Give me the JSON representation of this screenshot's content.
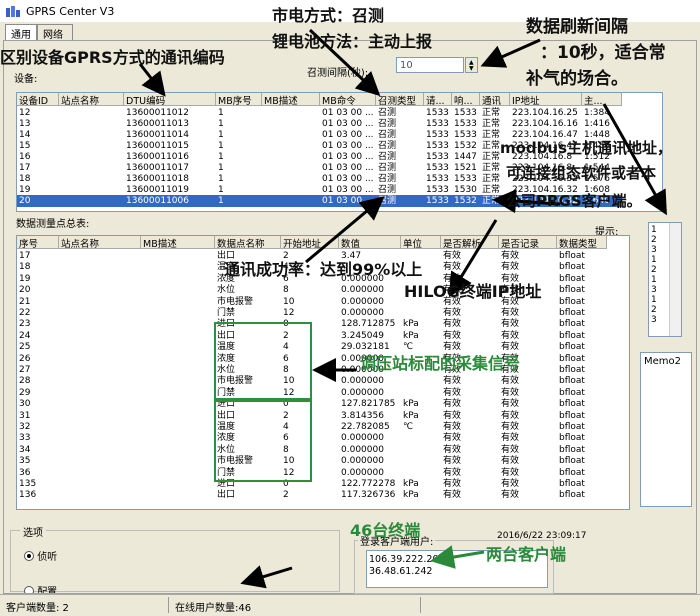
{
  "window": {
    "title": "GPRS Center V3"
  },
  "tabs": [
    "通用",
    "网络"
  ],
  "labels": {
    "devices": "设备:",
    "poll_interval": "召测间隔(秒):",
    "data_points_summary": "数据测量点总表:",
    "hint": "提示:",
    "options": "选项",
    "login_users": "登录客户端用户:",
    "datetime": "2016/6/22 23:09:17"
  },
  "poll_interval_value": "10",
  "device_table": {
    "columns": [
      "设备ID",
      "站点名称",
      "DTU编码",
      "MB序号",
      "MB描述",
      "MB命令",
      "召测类型",
      "请...",
      "响...",
      "通讯",
      "IP地址",
      "主..."
    ],
    "rows": [
      [
        "12",
        "",
        "13600011012",
        "1",
        "",
        "01 03 00 ...",
        "召测",
        "1533",
        "1533",
        "正常",
        "223.104.16.25",
        "1:384"
      ],
      [
        "13",
        "",
        "13600011013",
        "1",
        "",
        "01 03 00 ...",
        "召测",
        "1533",
        "1533",
        "正常",
        "223.104.16.16",
        "1:416"
      ],
      [
        "14",
        "",
        "13600011014",
        "1",
        "",
        "01 03 00 ...",
        "召测",
        "1533",
        "1533",
        "正常",
        "223.104.16.47",
        "1:448"
      ],
      [
        "15",
        "",
        "13600011015",
        "1",
        "",
        "01 03 00 ...",
        "召测",
        "1533",
        "1532",
        "正常",
        "223.104.16.47",
        "1:480"
      ],
      [
        "16",
        "",
        "13600011016",
        "1",
        "",
        "01 03 00 ...",
        "召测",
        "1533",
        "1447",
        "正常",
        "223.104.16.8",
        "1:512"
      ],
      [
        "17",
        "",
        "13600011017",
        "1",
        "",
        "01 03 00 ...",
        "召测",
        "1533",
        "1521",
        "正常",
        "223.104.16.8",
        "1:544"
      ],
      [
        "18",
        "",
        "13600011018",
        "1",
        "",
        "01 03 00 ...",
        "召测",
        "1533",
        "1533",
        "正常",
        "223.104.16.32",
        "1:576"
      ],
      [
        "19",
        "",
        "13600011019",
        "1",
        "",
        "01 03 00 ...",
        "召测",
        "1533",
        "1530",
        "正常",
        "223.104.16.32",
        "1:608"
      ],
      [
        "20",
        "",
        "13600011006",
        "1",
        "",
        "01 03 00 ...",
        "召测",
        "1533",
        "1532",
        "正常",
        "223.104.16.32",
        "1:640"
      ]
    ]
  },
  "points_table": {
    "columns": [
      "序号",
      "站点名称",
      "MB描述",
      "数据点名称",
      "开始地址",
      "数值",
      "单位",
      "是否解析",
      "是否记录",
      "数据类型"
    ],
    "rows": [
      [
        "17",
        "",
        "",
        "出口",
        "2",
        "3.47",
        "",
        "有效",
        "有效",
        "bfloat"
      ],
      [
        "18",
        "",
        "",
        "温度",
        "4",
        "",
        "",
        "有效",
        "有效",
        "bfloat"
      ],
      [
        "19",
        "",
        "",
        "浓度",
        "6",
        "0.000000",
        "",
        "有效",
        "有效",
        "bfloat"
      ],
      [
        "20",
        "",
        "",
        "水位",
        "8",
        "0.000000",
        "",
        "有效",
        "有效",
        "bfloat"
      ],
      [
        "21",
        "",
        "",
        "市电报警",
        "10",
        "0.000000",
        "",
        "有效",
        "有效",
        "bfloat"
      ],
      [
        "22",
        "",
        "",
        "门禁",
        "12",
        "0.000000",
        "",
        "有效",
        "有效",
        "bfloat"
      ],
      [
        "23",
        "",
        "",
        "进口",
        "0",
        "128.712875",
        "kPa",
        "有效",
        "有效",
        "bfloat"
      ],
      [
        "24",
        "",
        "",
        "出口",
        "2",
        "3.245049",
        "kPa",
        "有效",
        "有效",
        "bfloat"
      ],
      [
        "25",
        "",
        "",
        "温度",
        "4",
        "29.032181",
        "℃",
        "有效",
        "有效",
        "bfloat"
      ],
      [
        "26",
        "",
        "",
        "浓度",
        "6",
        "0.000000",
        "",
        "有效",
        "有效",
        "bfloat"
      ],
      [
        "27",
        "",
        "",
        "水位",
        "8",
        "0.000000",
        "",
        "有效",
        "有效",
        "bfloat"
      ],
      [
        "28",
        "",
        "",
        "市电报警",
        "10",
        "0.000000",
        "",
        "有效",
        "有效",
        "bfloat"
      ],
      [
        "29",
        "",
        "",
        "门禁",
        "12",
        "0.000000",
        "",
        "有效",
        "有效",
        "bfloat"
      ],
      [
        "30",
        "",
        "",
        "进口",
        "0",
        "127.821785",
        "kPa",
        "有效",
        "有效",
        "bfloat"
      ],
      [
        "31",
        "",
        "",
        "出口",
        "2",
        "3.814356",
        "kPa",
        "有效",
        "有效",
        "bfloat"
      ],
      [
        "32",
        "",
        "",
        "温度",
        "4",
        "22.782085",
        "℃",
        "有效",
        "有效",
        "bfloat"
      ],
      [
        "33",
        "",
        "",
        "浓度",
        "6",
        "0.000000",
        "",
        "有效",
        "有效",
        "bfloat"
      ],
      [
        "34",
        "",
        "",
        "水位",
        "8",
        "0.000000",
        "",
        "有效",
        "有效",
        "bfloat"
      ],
      [
        "35",
        "",
        "",
        "市电报警",
        "10",
        "0.000000",
        "",
        "有效",
        "有效",
        "bfloat"
      ],
      [
        "36",
        "",
        "",
        "门禁",
        "12",
        "0.000000",
        "",
        "有效",
        "有效",
        "bfloat"
      ],
      [
        "135",
        "",
        "",
        "进口",
        "0",
        "122.772278",
        "kPa",
        "有效",
        "有效",
        "bfloat"
      ],
      [
        "136",
        "",
        "",
        "出口",
        "2",
        "117.326736",
        "kPa",
        "有效",
        "有效",
        "bfloat"
      ]
    ]
  },
  "hint_list": [
    "1",
    "2",
    "3",
    "1",
    "2",
    "1",
    "3",
    "1",
    "2",
    "3"
  ],
  "memo_label": "Memo2",
  "options": {
    "listen_label": "侦听",
    "config_label": "配置"
  },
  "clients": [
    "106.39.222.207",
    "36.48.61.242"
  ],
  "status": {
    "clients_count": "客户端数量: 2",
    "online_users": "在线用户数量:46"
  },
  "annotations": {
    "a1": "市电方式：召测",
    "a2": "锂电池方法：主动上报",
    "a3": "数据刷新间隔",
    "a4": "：10秒，适合常",
    "a5": "补气的场合。",
    "a6": "区别设备GPRS方式的通讯编码",
    "a7": "modbus主机通讯地址，",
    "a8": "可连接组态软件或者本",
    "a9": "公司PRGS客户端。",
    "a10": "通讯成功率：达到99%以上",
    "a11": "HILOG终端IP地址",
    "a12": "调压站标配的采集信号",
    "a13": "46台终端",
    "a14": "两台客户端"
  },
  "colors": {
    "selection": "#316ac5",
    "annotation_green": "#2a8a3a",
    "box_green": "#2f8f3a"
  }
}
